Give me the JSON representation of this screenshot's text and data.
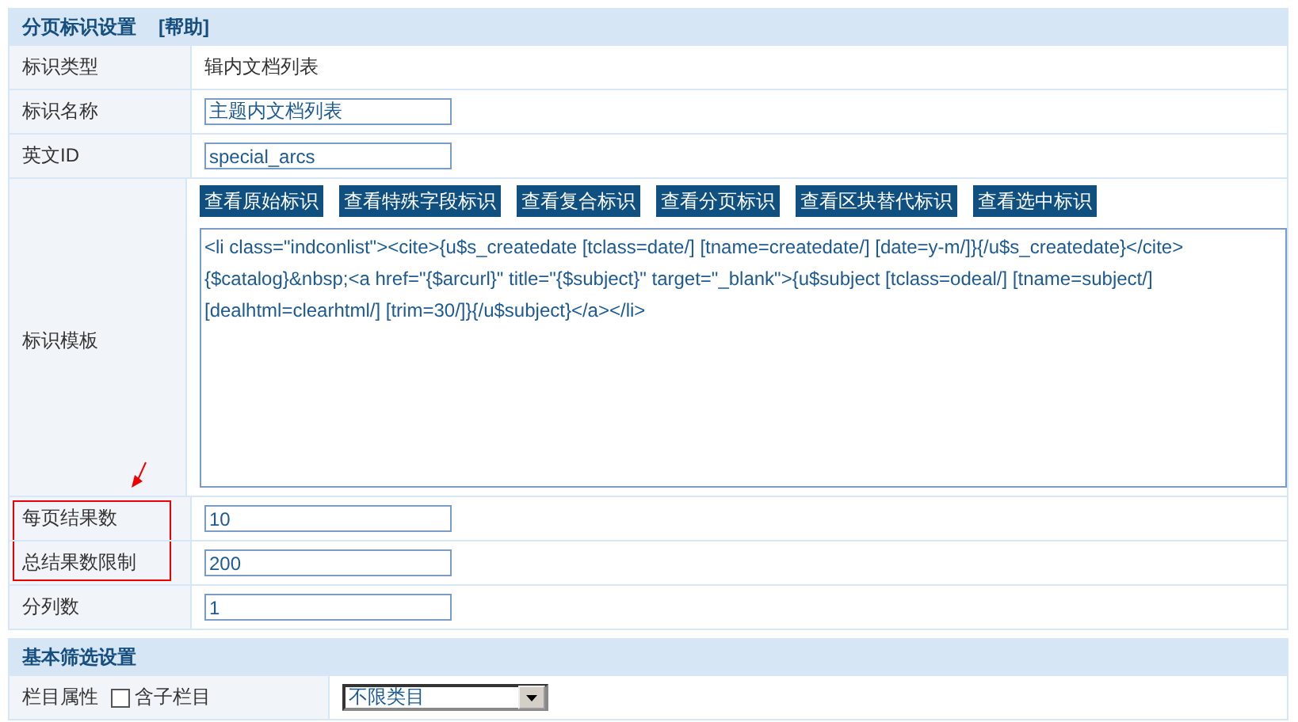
{
  "section": {
    "title": "分页标识设置",
    "help_link": "[帮助]"
  },
  "rows": [
    {
      "kind": "text",
      "label": "标识类型",
      "value": "辑内文档列表"
    },
    {
      "kind": "input",
      "label": "标识名称",
      "value": "主题内文档列表"
    },
    {
      "kind": "input",
      "label": "英文ID",
      "value": "special_arcs"
    },
    {
      "kind": "template",
      "label": "标识模板",
      "buttons": [
        "查看原始标识",
        "查看特殊字段标识",
        "查看复合标识",
        "查看分页标识",
        "查看区块替代标识",
        "查看选中标识"
      ],
      "value": "<li class=\"indconlist\"><cite>{u$s_createdate [tclass=date/] [tname=createdate/] [date=y-m/]}{/u$s_createdate}</cite>{$catalog}&nbsp;<a href=\"{$arcurl}\" title=\"{$subject}\" target=\"_blank\">{u$subject [tclass=odeal/] [tname=subject/] [dealhtml=clearhtml/] [trim=30/]}{/u$subject}</a></li>"
    },
    {
      "kind": "input",
      "label": "每页结果数",
      "value": "10",
      "highlighted": true
    },
    {
      "kind": "input",
      "label": "总结果数限制",
      "value": "200",
      "highlighted": true
    },
    {
      "kind": "input",
      "label": "分列数",
      "value": "1",
      "highlighted": false
    }
  ],
  "section2": {
    "title": "基本筛选设置"
  },
  "filter_row": {
    "label": "栏目属性",
    "checkbox": {
      "label": "含子栏目",
      "checked": false
    },
    "select": {
      "value": "不限类目"
    }
  }
}
